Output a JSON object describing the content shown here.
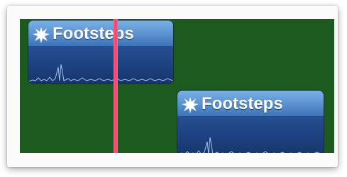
{
  "timeline": {
    "clips": [
      {
        "label": "Footsteps",
        "icon": "burst-icon"
      },
      {
        "label": "Footsteps",
        "icon": "burst-icon"
      }
    ],
    "colors": {
      "timeline_bg": "#1d5a1f",
      "clip_header": "#5f97d4",
      "clip_wave": "#1c3f7c",
      "playhead": "#ff3a6a"
    }
  }
}
